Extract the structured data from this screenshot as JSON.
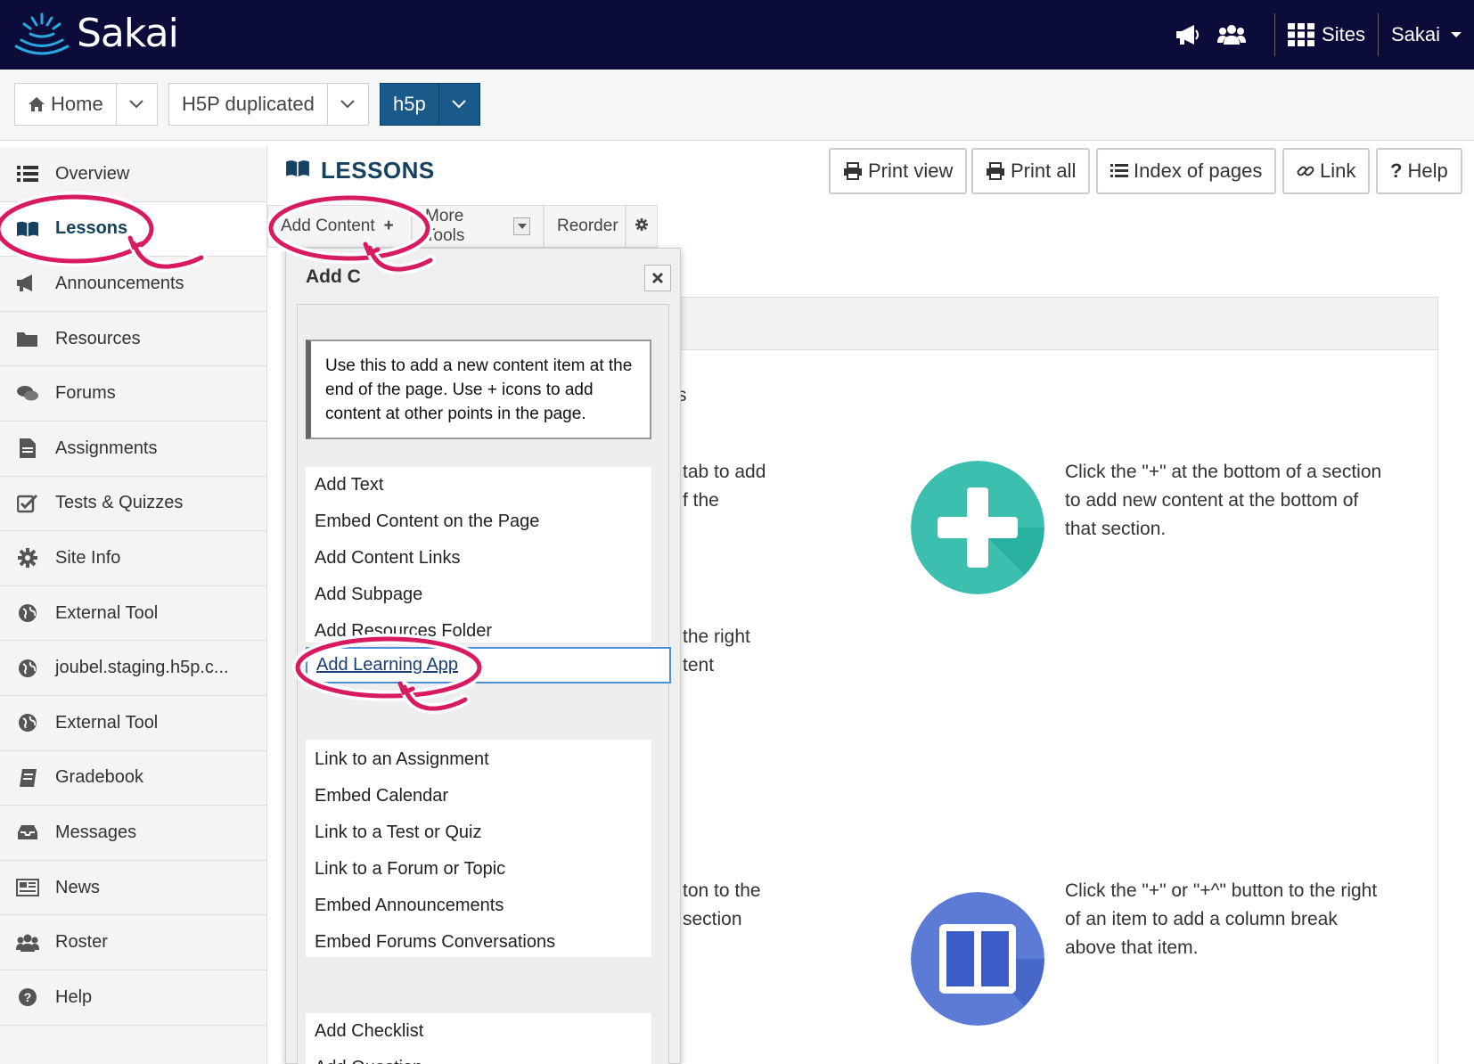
{
  "topbar": {
    "logo_text": "Sakai",
    "sites_label": "Sites",
    "user_label": "Sakai"
  },
  "sitebar": {
    "tabs": [
      {
        "label": "Home"
      },
      {
        "label": "H5P duplicated"
      },
      {
        "label": "h5p"
      }
    ]
  },
  "leftnav": {
    "items": [
      {
        "label": "Overview",
        "icon": "list-icon"
      },
      {
        "label": "Lessons",
        "icon": "book-icon"
      },
      {
        "label": "Announcements",
        "icon": "megaphone-icon"
      },
      {
        "label": "Resources",
        "icon": "folder-icon"
      },
      {
        "label": "Forums",
        "icon": "comments-icon"
      },
      {
        "label": "Assignments",
        "icon": "file-icon"
      },
      {
        "label": "Tests & Quizzes",
        "icon": "checkbox-icon"
      },
      {
        "label": "Site Info",
        "icon": "gear-icon"
      },
      {
        "label": "External Tool",
        "icon": "globe-icon"
      },
      {
        "label": "joubel.staging.h5p.c...",
        "icon": "globe-icon"
      },
      {
        "label": "External Tool",
        "icon": "globe-icon"
      },
      {
        "label": "Gradebook",
        "icon": "gradebook-icon"
      },
      {
        "label": "Messages",
        "icon": "inbox-icon"
      },
      {
        "label": "News",
        "icon": "newspaper-icon"
      },
      {
        "label": "Roster",
        "icon": "users-icon"
      },
      {
        "label": "Help",
        "icon": "question-icon"
      }
    ]
  },
  "main": {
    "title": "LESSONS",
    "toolbar": {
      "print_view": "Print view",
      "print_all": "Print all",
      "index_of_pages": "Index of pages",
      "link": "Link",
      "help": "Help"
    },
    "tools": {
      "add_content": "Add Content",
      "more_tools": "More Tools",
      "reorder": "Reorder"
    },
    "background": {
      "frag1": "tab to add",
      "frag2": "f the",
      "frag3": "the right",
      "frag4": "tent",
      "frag5": "ton to the",
      "frag6": "section",
      "frag7": "s",
      "card1": "Click the \"+\" at the bottom of a section to add new content at the bottom of that section.",
      "card2": "Click the \"+\" or \"+^\" button to the right of an item to add a column break above that item."
    }
  },
  "dialog": {
    "title": "Add C",
    "note": "Use this to add a new content item at the end of the page. Use + icons to add content at other points in the page.",
    "group1": [
      "Add Text",
      "Embed Content on the Page",
      "Add Content Links",
      "Add Subpage",
      "Add Resources Folder"
    ],
    "focused_item": "Add Learning App",
    "group2": [
      "Link to an Assignment",
      "Embed Calendar",
      "Link to a Test or Quiz",
      "Link to a Forum or Topic",
      "Embed Announcements",
      "Embed Forums Conversations"
    ],
    "group3": [
      "Add Checklist",
      "Add Question"
    ]
  },
  "colors": {
    "topbar": "#0b0c3a",
    "active_site_tab": "#1a5a8a",
    "title": "#16415f",
    "annotation": "#d81b60",
    "plus_circle": "#3dbfb0",
    "columns_circle": "#5b7bd5"
  }
}
